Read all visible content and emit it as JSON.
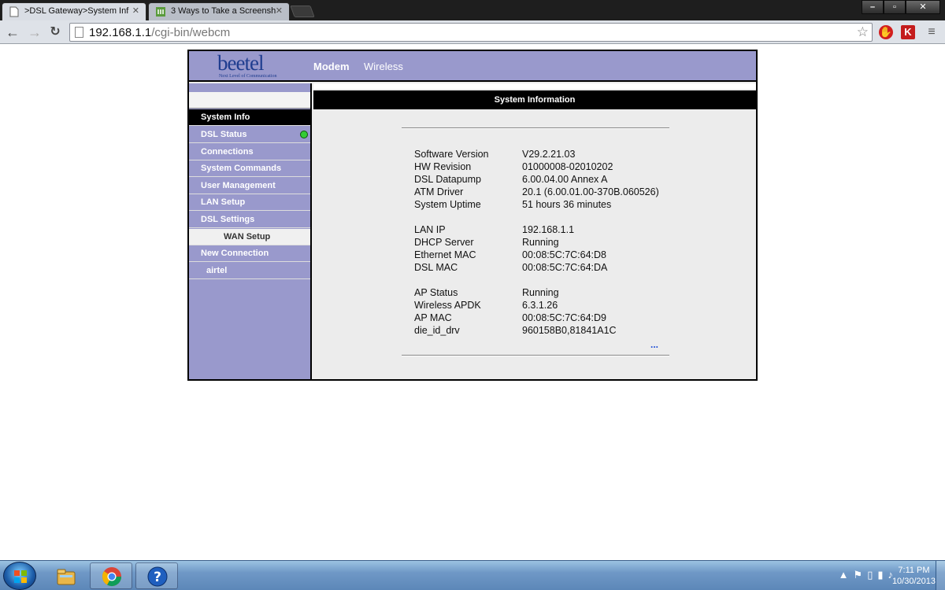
{
  "browser": {
    "tabs": [
      {
        "title": ">DSL Gateway>System Inf",
        "favicon": "page-icon"
      },
      {
        "title": "3 Ways to Take a Screensh",
        "favicon": "wikihow-icon"
      }
    ],
    "url_host": "192.168.1.1",
    "url_path": "/cgi-bin/webcm",
    "window_buttons": {
      "minimize": "–",
      "restore": "▫",
      "close": "✕"
    }
  },
  "router": {
    "logo": {
      "word": "beetel",
      "tagline": "Next Level of Communication"
    },
    "top_tabs": {
      "modem": "Modem",
      "wireless": "Wireless"
    },
    "sidebar": {
      "system_info": "System Info",
      "dsl_status": "DSL Status",
      "connections": "Connections",
      "system_commands": "System Commands",
      "user_management": "User Management",
      "lan_setup": "LAN Setup",
      "dsl_settings": "DSL Settings",
      "wan_setup": "WAN Setup",
      "new_connection": "New Connection",
      "airtel": "airtel"
    },
    "page_title": "System Information",
    "info": {
      "software_version": {
        "label": "Software Version",
        "value": "V29.2.21.03"
      },
      "hw_revision": {
        "label": "HW Revision",
        "value": "01000008-02010202"
      },
      "dsl_datapump": {
        "label": "DSL Datapump",
        "value": "6.00.04.00 Annex A"
      },
      "atm_driver": {
        "label": "ATM Driver",
        "value": "20.1 (6.00.01.00-370B.060526)"
      },
      "system_uptime": {
        "label": "System Uptime",
        "value": "51 hours 36 minutes"
      },
      "lan_ip": {
        "label": "LAN IP",
        "value": "192.168.1.1"
      },
      "dhcp_server": {
        "label": "DHCP Server",
        "value": "Running"
      },
      "ethernet_mac": {
        "label": "Ethernet MAC",
        "value": "00:08:5C:7C:64:D8"
      },
      "dsl_mac": {
        "label": "DSL MAC",
        "value": "00:08:5C:7C:64:DA"
      },
      "ap_status": {
        "label": "AP Status",
        "value": "Running"
      },
      "wireless_apdk": {
        "label": "Wireless APDK",
        "value": "6.3.1.26"
      },
      "ap_mac": {
        "label": "AP MAC",
        "value": "00:08:5C:7C:64:D9"
      },
      "die_id_drv": {
        "label": "die_id_drv",
        "value": "960158B0,81841A1C"
      }
    },
    "more_link": "..."
  },
  "taskbar": {
    "time": "7:11 PM",
    "date": "10/30/2013",
    "apps": [
      "explorer-icon",
      "chrome-icon",
      "help-icon"
    ]
  },
  "colors": {
    "nav_purple": "#9999cc",
    "title_black": "#000000",
    "status_green": "#33cc33"
  }
}
